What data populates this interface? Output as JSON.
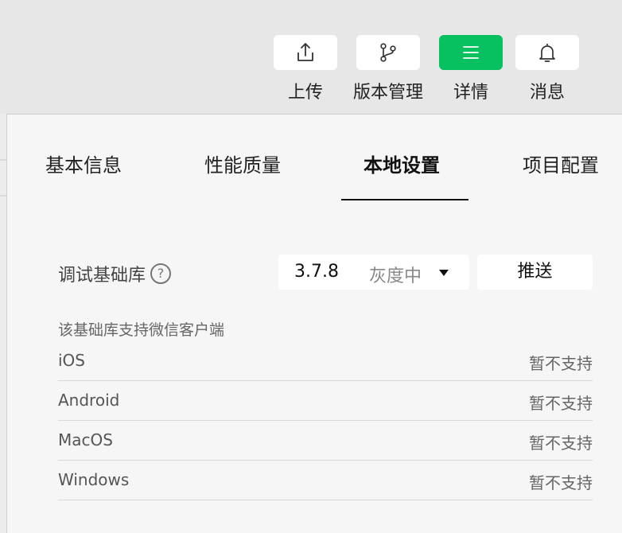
{
  "toolbar": {
    "items": [
      {
        "label": "上传",
        "icon": "upload-icon",
        "active": false
      },
      {
        "label": "版本管理",
        "icon": "branch-icon",
        "active": false
      },
      {
        "label": "详情",
        "icon": "menu-icon",
        "active": true
      },
      {
        "label": "消息",
        "icon": "bell-icon",
        "active": false
      }
    ],
    "accent": "#07c160"
  },
  "tabs": [
    {
      "label": "基本信息",
      "active": false
    },
    {
      "label": "性能质量",
      "active": false
    },
    {
      "label": "本地设置",
      "active": true
    },
    {
      "label": "项目配置",
      "active": false
    }
  ],
  "base_library": {
    "label": "调试基础库",
    "help_icon": "?",
    "version": "3.7.8",
    "status": "灰度中",
    "push_label": "推送"
  },
  "support": {
    "title": "该基础库支持微信客户端",
    "clients": [
      {
        "name": "iOS",
        "status": "暂不支持"
      },
      {
        "name": "Android",
        "status": "暂不支持"
      },
      {
        "name": "MacOS",
        "status": "暂不支持"
      },
      {
        "name": "Windows",
        "status": "暂不支持"
      }
    ]
  }
}
